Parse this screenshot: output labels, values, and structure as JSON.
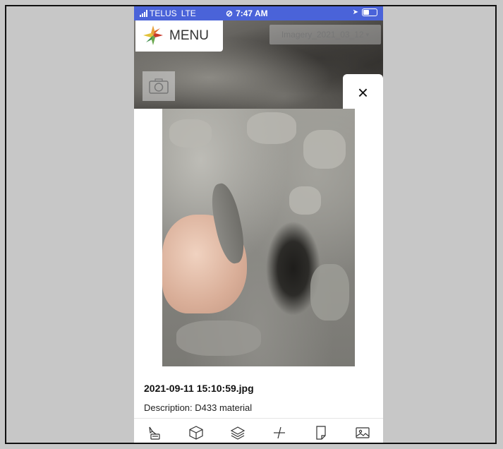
{
  "status_bar": {
    "carrier": "TELUS",
    "network": "LTE",
    "time": "7:47 AM"
  },
  "header": {
    "menu_label": "MENU",
    "imagery_select": "Imagery_2021_03_12"
  },
  "modal": {
    "close_label": "×",
    "photo_filename": "2021-09-11 15:10:59.jpg",
    "description": "Description: D433 material"
  },
  "toolbar": {
    "icons": [
      "survey-icon",
      "cube-icon",
      "layers-icon",
      "measure-icon",
      "document-icon",
      "image-icon"
    ]
  },
  "colors": {
    "status_bar": "#4a63d9",
    "frame_background": "#c7c7c7"
  }
}
